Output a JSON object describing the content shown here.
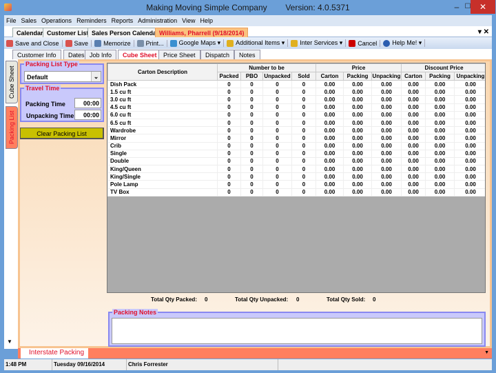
{
  "window": {
    "title": "Making Moving Simple Company",
    "version": "Version: 4.0.5371",
    "minimize": "–",
    "maximize": "☐",
    "close": "✕"
  },
  "menu": [
    "File",
    "Sales",
    "Operations",
    "Reminders",
    "Reports",
    "Administration",
    "View",
    "Help"
  ],
  "doc_tabs": [
    "Calendar",
    "Customer List",
    "Sales Person Calendar",
    "Williams, Pharrell  (9/18/2014)"
  ],
  "doc_tab_controls": "▾ ✕",
  "toolbar": [
    "Save and Close",
    "Save",
    "Memorize",
    "Print...",
    "Google Maps ▾",
    "Additional Items ▾",
    "Inter Services ▾",
    "Cancel",
    "Help Me! ▾"
  ],
  "sub_tabs": [
    "Customer Info",
    "Dates",
    "Job Info",
    "Cube Sheet",
    "Price Sheet",
    "Dispatch",
    "Notes"
  ],
  "side_tabs": [
    "Cube Sheet",
    "Packing List"
  ],
  "packing_list_type": {
    "title": "Packing List Type",
    "value": "Default"
  },
  "travel_time": {
    "title": "Travel Time",
    "packing_label": "Packing Time",
    "packing_value": "00:00",
    "unpacking_label": "Unpacking Time",
    "unpacking_value": "00:00"
  },
  "clear_button": "Clear Packing List",
  "grid": {
    "group_headers": [
      "Carton Description",
      "Number to be",
      "Price",
      "Discount Price"
    ],
    "columns": [
      "Packed",
      "PBO",
      "Unpacked",
      "Sold",
      "Carton",
      "Packing",
      "Unpacking",
      "Carton",
      "Packing",
      "Unpacking"
    ],
    "rows": [
      "Dish Pack",
      "1.5 cu ft",
      "3.0 cu ft",
      "4.5 cu ft",
      "6.0 cu ft",
      "6.5 cu ft",
      "Wardrobe",
      "Mirror",
      "Crib",
      "Single",
      "Double",
      "King/Queen",
      "King/Single",
      "Pole Lamp",
      "TV Box"
    ],
    "qty_value": "0",
    "price_value": "0.00"
  },
  "totals": {
    "packed_label": "Total Qty Packed:",
    "packed": "0",
    "unpacked_label": "Total Qty Unpacked:",
    "unpacked": "0",
    "sold_label": "Total Qty Sold:",
    "sold": "0"
  },
  "packing_notes": {
    "title": "Packing Notes",
    "value": ""
  },
  "bottom_tab": "Interstate Packing",
  "status": {
    "time": "1:48 PM",
    "date": "Tuesday 09/16/2014",
    "user": "Chris Forrester"
  },
  "colors": {
    "accent_red": "#e0102a",
    "panel_orange": "#ff7f5f",
    "group_blue": "#c9c9fb",
    "clear_button": "#c8c000"
  }
}
